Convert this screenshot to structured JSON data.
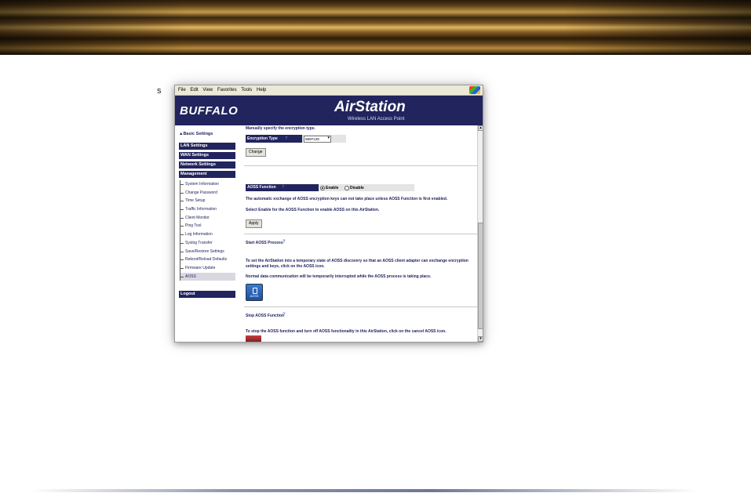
{
  "colors": {
    "header": "#22245e",
    "nav": "#22245e",
    "accent": "#5a7ad8"
  },
  "stray_text": "s",
  "menubar": [
    "File",
    "Edit",
    "View",
    "Favorites",
    "Tools",
    "Help"
  ],
  "header": {
    "brand": "BUFFALO",
    "product": "AirStation",
    "subtitle": "Wireless LAN Access Point"
  },
  "sidebar": {
    "basic_settings": "▲Basic Settings",
    "sections": [
      "LAN Settings",
      "WAN Settings",
      "Network Settings",
      "Management"
    ],
    "items": [
      "System Information",
      "Change Password",
      "Time Setup",
      "Traffic Information",
      "Client Monitor",
      "Ping Tool",
      "Log Information",
      "Syslog Transfer",
      "Save/Restore Settings",
      "Reboot/Reload Defaults",
      "Firmware Update",
      "AOSS"
    ],
    "active_item": "AOSS",
    "logout": "Logout"
  },
  "content": {
    "intro": "Manually specify the encryption type.",
    "encryption_label": "Encryption Type",
    "encryption_value": "WEP128",
    "change_button": "Change",
    "aoss_function_label": "AOSS Function",
    "enable_label": "Enable",
    "disable_label": "Disable",
    "aoss_selected": "Enable",
    "aoss_note1": "The automatic exchange of AOSS encryption keys can not take place unless AOSS Function is first enabled.",
    "aoss_note2": "Select Enable for the AOSS Function to enable AOSS on this AirStation.",
    "apply_button": "Apply",
    "start_heading": "Start AOSS Process",
    "start_text1": "To set the AirStation into a temporary state of AOSS discovery so that an AOSS client adapter can exchange encryption settings and keys, click on the AOSS icon.",
    "start_text2": "Normal data communication will be temporarily interrupted while the AOSS process is taking place.",
    "aoss_icon_label": "AOSS",
    "stop_heading": "Stop AOSS Function",
    "stop_text": "To stop the AOSS function and turn off AOSS functionality in this AirStation, click on the cancel AOSS icon."
  },
  "icons": {
    "help": "question-mark-icon",
    "aoss": "aoss-button-icon",
    "cancel": "cancel-aoss-icon"
  }
}
